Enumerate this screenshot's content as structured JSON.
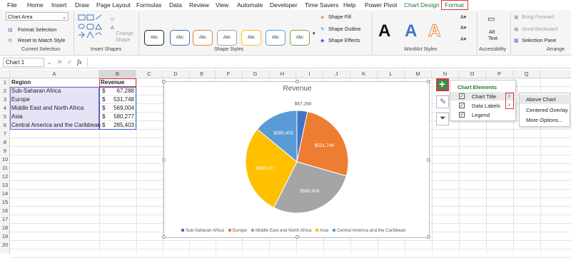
{
  "menu": {
    "tabs": [
      "File",
      "Home",
      "Insert",
      "Draw",
      "Page Layout",
      "Formulas",
      "Data",
      "Review",
      "View",
      "Automate",
      "Developer",
      "Time Savers",
      "Help",
      "Power Pivot",
      "Chart Design",
      "Format"
    ]
  },
  "ribbon": {
    "selection_dropdown": "Chart Area",
    "format_selection": "Format Selection",
    "reset_to_match_style": "Reset to Match Style",
    "current_selection_label": "Current Selection",
    "change_shape": "Change",
    "change_shape2": "Shape",
    "insert_shapes_label": "Insert Shapes",
    "shape_style_boxes": [
      "Abc",
      "Abc",
      "Abc",
      "Abc",
      "Abc",
      "Abc",
      "Abc"
    ],
    "shape_fill": "Shape Fill",
    "shape_outline": "Shape Outline",
    "shape_effects": "Shape Effects",
    "shape_styles_label": "Shape Styles",
    "wordart_letters": [
      "A",
      "A",
      "A"
    ],
    "wordart_label": "WordArt Styles",
    "alt_text_1": "Alt",
    "alt_text_2": "Text",
    "accessibility_label": "Accessibility",
    "bring_forward": "Bring Forward",
    "send_backward": "Send Backward",
    "selection_pane": "Selection Pane",
    "arrange_label": "Arrange"
  },
  "formula_bar": {
    "name_box": "Chart 1",
    "fx": "fx",
    "value": ""
  },
  "grid": {
    "columns": [
      "A",
      "B",
      "C",
      "D",
      "E",
      "F",
      "G",
      "H",
      "I",
      "J",
      "K",
      "L",
      "M",
      "N",
      "O",
      "P",
      "Q"
    ],
    "rows": [
      "1",
      "2",
      "3",
      "4",
      "5",
      "6",
      "7",
      "8",
      "9",
      "10",
      "11",
      "12",
      "13",
      "14",
      "15",
      "16",
      "17",
      "18",
      "19",
      "20"
    ],
    "header": {
      "region": "Region",
      "revenue": "Revenue"
    },
    "data": [
      {
        "region": "Sub-Saharan Africa",
        "currency": "$",
        "value": "67,288"
      },
      {
        "region": "Europe",
        "currency": "$",
        "value": "531,748"
      },
      {
        "region": "Middle East and North Africa",
        "currency": "$",
        "value": "569,004"
      },
      {
        "region": "Asia",
        "currency": "$",
        "value": "580,277"
      },
      {
        "region": "Central America and the Caribbean",
        "currency": "$",
        "value": "285,403"
      }
    ]
  },
  "chart_data": {
    "type": "pie",
    "title": "Revenue",
    "categories": [
      "Sub-Saharan Africa",
      "Europe",
      "Middle East and North Africa",
      "Asia",
      "Central America and the Caribbean"
    ],
    "values": [
      67288,
      531748,
      569004,
      580277,
      285403
    ],
    "data_labels": [
      "$67,288",
      "$531,748",
      "$569,004",
      "$580,277",
      "$285,403"
    ],
    "colors": [
      "#4472c4",
      "#ed7d31",
      "#a5a5a5",
      "#ffc000",
      "#5b9bd5"
    ],
    "legend_position": "bottom"
  },
  "chart_elements_panel": {
    "title": "Chart Elements",
    "items": [
      {
        "label": "Chart Title",
        "checked": true
      },
      {
        "label": "Data Labels",
        "checked": true
      },
      {
        "label": "Legend",
        "checked": true
      }
    ]
  },
  "title_submenu": {
    "items": [
      "Above Chart",
      "Centered Overlay",
      "More Options..."
    ]
  },
  "colors": {
    "excel_green": "#1e7a3c",
    "highlight_red": "#d9363e",
    "selection_purple": "#7b68c9"
  }
}
